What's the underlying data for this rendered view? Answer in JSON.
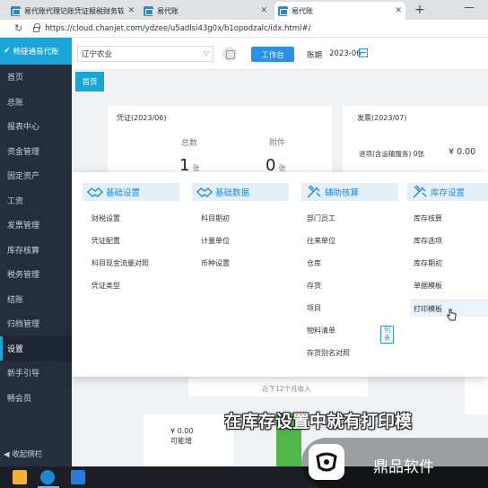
{
  "browser": {
    "tabs": [
      {
        "title": "易代账代理记账凭证报税财务软件",
        "active": false
      },
      {
        "title": "易代账",
        "active": false
      },
      {
        "title": "易代账",
        "active": true
      }
    ],
    "new_tab_label": "+",
    "minimize_label": "—",
    "url": "https://cloud.chanjet.com/ydzee/u5adlsi43g0x/b1opodzalc/idx.html#/"
  },
  "sidebar": {
    "brand": "畅捷通易代账",
    "items": [
      {
        "label": "首页"
      },
      {
        "label": "总账"
      },
      {
        "label": "报表中心"
      },
      {
        "label": "资金管理"
      },
      {
        "label": "固定资产"
      },
      {
        "label": "工资"
      },
      {
        "label": "发票管理"
      },
      {
        "label": "库存核算"
      },
      {
        "label": "税务管理"
      },
      {
        "label": "结账"
      },
      {
        "label": "归档管理"
      },
      {
        "label": "设置",
        "active": true
      },
      {
        "label": "新手引导"
      },
      {
        "label": "畅会员"
      }
    ],
    "collapse_label": "◀ 收起侧栏"
  },
  "appbar": {
    "org_name": "辽宁农业",
    "workbench_label": "工作台",
    "period_label": "账期",
    "period_value": "2023-06"
  },
  "page_tab": {
    "label": "首页"
  },
  "dashboard": {
    "voucher_title": "凭证(2023/06)",
    "total_label": "总数",
    "total_value": "1",
    "total_unit": "张",
    "attach_label": "附件",
    "attach_value": "0",
    "attach_unit": "张",
    "invoice_title": "发票(2023/07)",
    "invoice_row": "进项(含运输服务)  0张",
    "invoice_amount": "¥ 0.00",
    "income_caption": "近下12个月收入",
    "small_amount": "¥ 0.00",
    "small_note": "可能增"
  },
  "settings_menu": {
    "columns": [
      {
        "title": "基础设置",
        "items": [
          "财税设置",
          "凭证配置",
          "科目现金流量对照",
          "凭证类型"
        ]
      },
      {
        "title": "基础数据",
        "items": [
          "科目期初",
          "计量单位",
          "币种设置"
        ]
      },
      {
        "title": "辅助核算",
        "items": [
          "部门员工",
          "往来单位",
          "仓库",
          "存货",
          "项目",
          "物料清单",
          "存货别名对照"
        ],
        "tag": "列表"
      },
      {
        "title": "库存设置",
        "items": [
          "库存核算",
          "库存选项",
          "库存期初",
          "单据模板",
          "打印模板"
        ]
      }
    ]
  },
  "subtitle": "在库存设置中就有打印模",
  "watermark": {
    "text": "鼎品软件"
  },
  "colors": {
    "accent": "#1aa5d8",
    "primary_button": "#2c8fe8",
    "sidebar_bg": "#252e3d",
    "menu_title": "#1f8ad8"
  }
}
